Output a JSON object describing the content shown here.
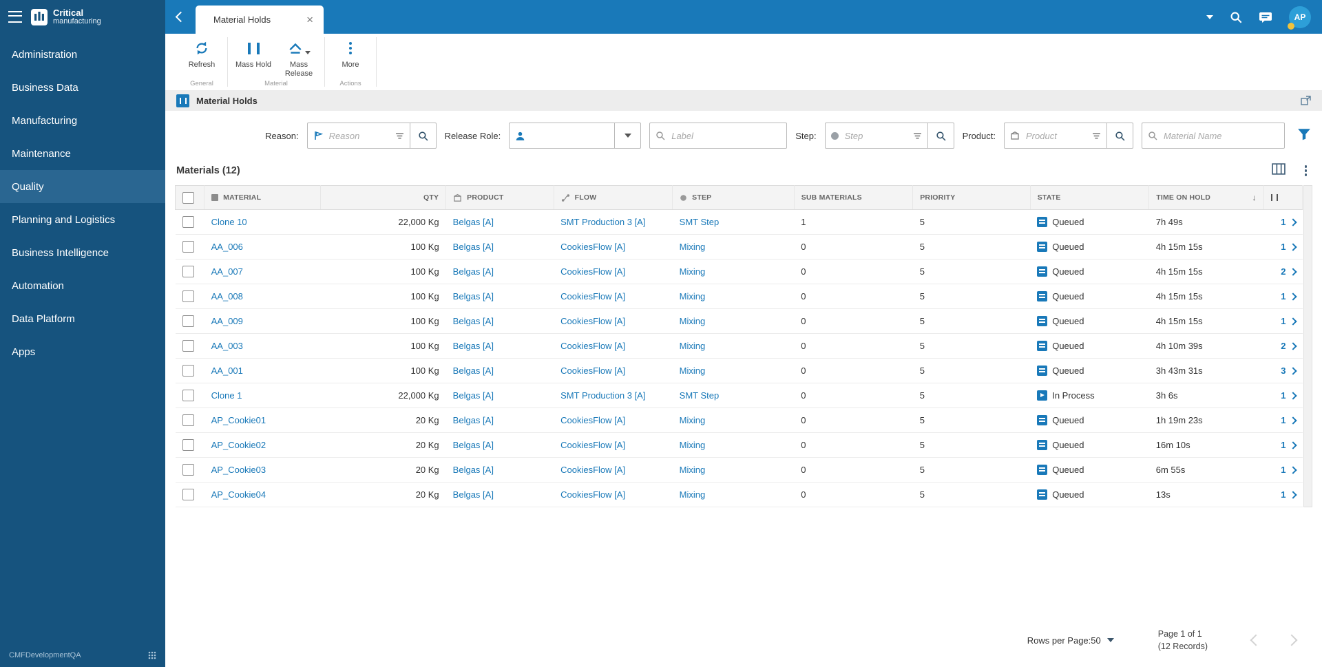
{
  "colors": {
    "accent": "#1979b9",
    "sidebar": "#16537e",
    "link": "#1878b8",
    "badge": "#f0c33c"
  },
  "sidebar": {
    "logo_line1": "Critical",
    "logo_line2": "manufacturing",
    "items": [
      {
        "label": "Administration",
        "active": false
      },
      {
        "label": "Business Data",
        "active": false
      },
      {
        "label": "Manufacturing",
        "active": false
      },
      {
        "label": "Maintenance",
        "active": false
      },
      {
        "label": "Quality",
        "active": true
      },
      {
        "label": "Planning and Logistics",
        "active": false
      },
      {
        "label": "Business Intelligence",
        "active": false
      },
      {
        "label": "Automation",
        "active": false
      },
      {
        "label": "Data Platform",
        "active": false
      },
      {
        "label": "Apps",
        "active": false
      }
    ],
    "footer_text": "CMFDevelopmentQA"
  },
  "topbar": {
    "tab_title": "Material Holds",
    "avatar_initials": "AP"
  },
  "toolbar": {
    "buttons": {
      "refresh": "Refresh",
      "mass_hold": "Mass Hold",
      "mass_release": "Mass Release",
      "more": "More"
    },
    "groups": {
      "general": "General",
      "material": "Material",
      "actions": "Actions"
    }
  },
  "page": {
    "title": "Material Holds"
  },
  "filters": {
    "reason": {
      "label": "Reason:",
      "placeholder": "Reason"
    },
    "release_role": {
      "label": "Release Role:"
    },
    "label_field": {
      "placeholder": "Label"
    },
    "step": {
      "label": "Step:",
      "placeholder": "Step"
    },
    "product": {
      "label": "Product:",
      "placeholder": "Product"
    },
    "material": {
      "placeholder": "Material Name"
    }
  },
  "materials": {
    "section_title": "Materials (12)",
    "columns": {
      "material": "MATERIAL",
      "qty": "QTY",
      "product": "PRODUCT",
      "flow": "FLOW",
      "step": "STEP",
      "sub_materials": "SUB MATERIALS",
      "priority": "PRIORITY",
      "state": "STATE",
      "time_on_hold": "TIME ON HOLD"
    },
    "rows": [
      {
        "material": "Clone 10",
        "qty": "22,000 Kg",
        "product": "Belgas [A]",
        "flow": "SMT Production 3 [A]",
        "step": "SMT Step",
        "sub_materials": "1",
        "priority": "5",
        "state": "Queued",
        "time_on_hold": "7h 49s",
        "holds": "1"
      },
      {
        "material": "AA_006",
        "qty": "100 Kg",
        "product": "Belgas [A]",
        "flow": "CookiesFlow [A]",
        "step": "Mixing",
        "sub_materials": "0",
        "priority": "5",
        "state": "Queued",
        "time_on_hold": "4h 15m 15s",
        "holds": "1"
      },
      {
        "material": "AA_007",
        "qty": "100 Kg",
        "product": "Belgas [A]",
        "flow": "CookiesFlow [A]",
        "step": "Mixing",
        "sub_materials": "0",
        "priority": "5",
        "state": "Queued",
        "time_on_hold": "4h 15m 15s",
        "holds": "2"
      },
      {
        "material": "AA_008",
        "qty": "100 Kg",
        "product": "Belgas [A]",
        "flow": "CookiesFlow [A]",
        "step": "Mixing",
        "sub_materials": "0",
        "priority": "5",
        "state": "Queued",
        "time_on_hold": "4h 15m 15s",
        "holds": "1"
      },
      {
        "material": "AA_009",
        "qty": "100 Kg",
        "product": "Belgas [A]",
        "flow": "CookiesFlow [A]",
        "step": "Mixing",
        "sub_materials": "0",
        "priority": "5",
        "state": "Queued",
        "time_on_hold": "4h 15m 15s",
        "holds": "1"
      },
      {
        "material": "AA_003",
        "qty": "100 Kg",
        "product": "Belgas [A]",
        "flow": "CookiesFlow [A]",
        "step": "Mixing",
        "sub_materials": "0",
        "priority": "5",
        "state": "Queued",
        "time_on_hold": "4h 10m 39s",
        "holds": "2"
      },
      {
        "material": "AA_001",
        "qty": "100 Kg",
        "product": "Belgas [A]",
        "flow": "CookiesFlow [A]",
        "step": "Mixing",
        "sub_materials": "0",
        "priority": "5",
        "state": "Queued",
        "time_on_hold": "3h 43m 31s",
        "holds": "3"
      },
      {
        "material": "Clone 1",
        "qty": "22,000 Kg",
        "product": "Belgas [A]",
        "flow": "SMT Production 3 [A]",
        "step": "SMT Step",
        "sub_materials": "0",
        "priority": "5",
        "state": "In Process",
        "time_on_hold": "3h 6s",
        "holds": "1"
      },
      {
        "material": "AP_Cookie01",
        "qty": "20 Kg",
        "product": "Belgas [A]",
        "flow": "CookiesFlow [A]",
        "step": "Mixing",
        "sub_materials": "0",
        "priority": "5",
        "state": "Queued",
        "time_on_hold": "1h 19m 23s",
        "holds": "1"
      },
      {
        "material": "AP_Cookie02",
        "qty": "20 Kg",
        "product": "Belgas [A]",
        "flow": "CookiesFlow [A]",
        "step": "Mixing",
        "sub_materials": "0",
        "priority": "5",
        "state": "Queued",
        "time_on_hold": "16m 10s",
        "holds": "1"
      },
      {
        "material": "AP_Cookie03",
        "qty": "20 Kg",
        "product": "Belgas [A]",
        "flow": "CookiesFlow [A]",
        "step": "Mixing",
        "sub_materials": "0",
        "priority": "5",
        "state": "Queued",
        "time_on_hold": "6m 55s",
        "holds": "1"
      },
      {
        "material": "AP_Cookie04",
        "qty": "20 Kg",
        "product": "Belgas [A]",
        "flow": "CookiesFlow [A]",
        "step": "Mixing",
        "sub_materials": "0",
        "priority": "5",
        "state": "Queued",
        "time_on_hold": "13s",
        "holds": "1"
      }
    ]
  },
  "footer": {
    "rows_per_page_label": "Rows per Page:",
    "rows_per_page_value": "50",
    "page_info": "Page 1 of 1",
    "records_info": "(12 Records)"
  }
}
